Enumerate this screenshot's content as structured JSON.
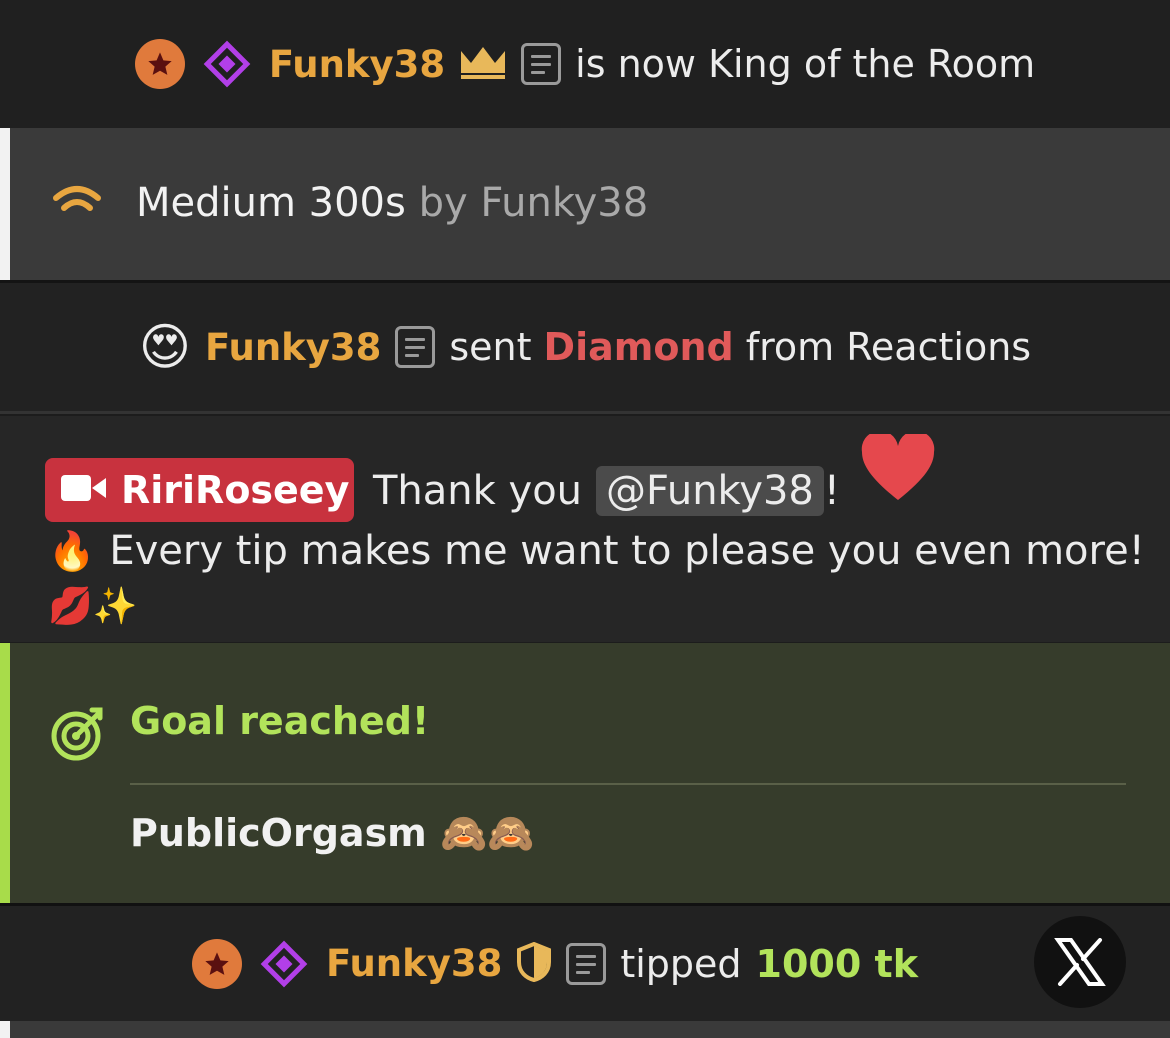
{
  "rows": {
    "king": {
      "username": "Funky38",
      "message": "is now King of the Room"
    },
    "toy": {
      "level": "Medium 300s",
      "by_text": "by Funky38"
    },
    "reaction": {
      "emoji": "😍",
      "username": "Funky38",
      "sent": "sent",
      "gift": "Diamond",
      "source": "from Reactions"
    },
    "broadcaster_message": {
      "broadcaster": "RiriRoseey",
      "thank": "Thank you",
      "mention": "@Funky38",
      "exclaim": "!",
      "heart_emoji": "❤️",
      "fire_emoji": "🔥",
      "line2": "Every tip makes me want to please you even more!",
      "line3_emojis": "💋✨"
    },
    "goal": {
      "title": "Goal reached!",
      "text": "PublicOrgasm 🙈🙈"
    },
    "tip": {
      "username": "Funky38",
      "tipped": "tipped",
      "amount": "1000 tk"
    }
  },
  "colors": {
    "username": "#e8a640",
    "goal_green": "#b2e35b",
    "diamond_red": "#e05a5a",
    "broadcaster_tag": "#c8323e",
    "purple_diamond": "#b23fe8"
  },
  "icons": {
    "star_badge": "star-badge-icon",
    "diamond": "diamond-icon",
    "crown": "crown-icon",
    "doc": "document-icon",
    "wifi": "signal-icon",
    "shield": "shield-icon",
    "target": "target-icon",
    "x_close": "x-logo-icon"
  }
}
